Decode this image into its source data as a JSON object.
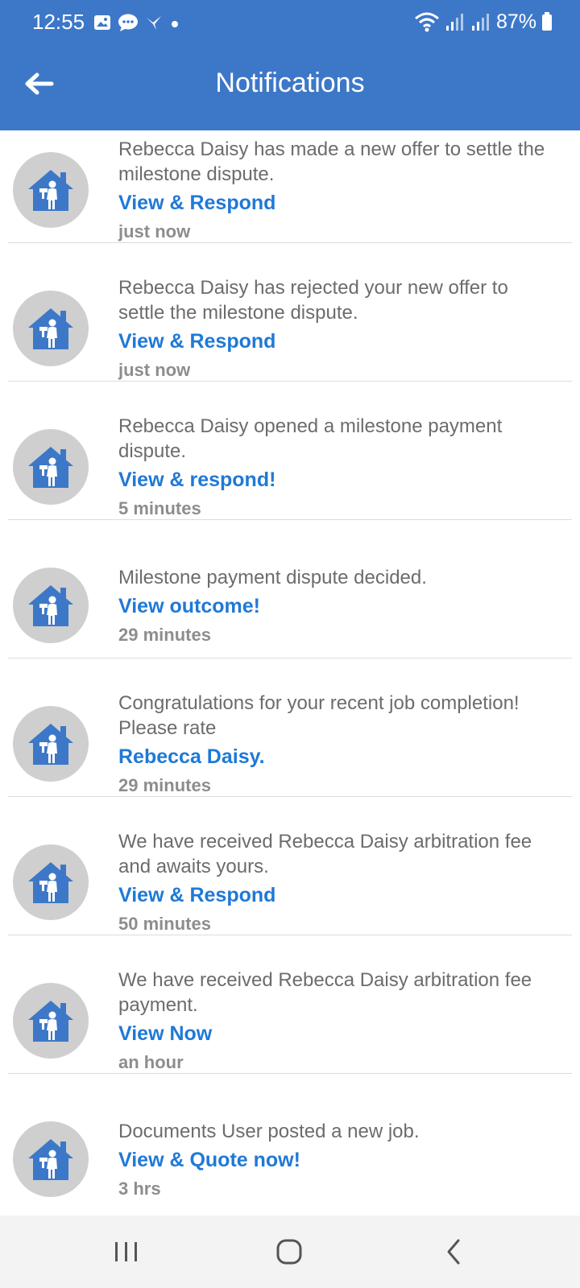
{
  "status_bar": {
    "time": "12:55",
    "battery": "87%"
  },
  "header": {
    "title": "Notifications"
  },
  "notifications": [
    {
      "message": "Rebecca Daisy has made a new offer to settle the milestone dispute.",
      "action": "View & Respond",
      "time": "just now"
    },
    {
      "message": "Rebecca Daisy has rejected your new offer to settle the milestone dispute.",
      "action": "View & Respond",
      "time": "just now"
    },
    {
      "message": "Rebecca Daisy opened a milestone payment dispute.",
      "action": "View & respond!",
      "time": "5 minutes"
    },
    {
      "message": "Milestone payment dispute decided.",
      "action": "View outcome!",
      "time": "29 minutes"
    },
    {
      "message": "Congratulations for your recent job completion! Please rate",
      "action": "Rebecca Daisy.",
      "time": "29 minutes"
    },
    {
      "message": "We have received Rebecca Daisy arbitration fee and awaits yours.",
      "action": "View & Respond",
      "time": "50 minutes"
    },
    {
      "message": "We have received Rebecca Daisy arbitration fee payment.",
      "action": "View Now",
      "time": "an hour"
    },
    {
      "message": "Documents User posted a new job.",
      "action": "View & Quote now!",
      "time": "3 hrs"
    }
  ],
  "colors": {
    "app_bar": "#3d78c8",
    "link": "#1f79d6",
    "avatar_bg": "#cfcfcf"
  }
}
